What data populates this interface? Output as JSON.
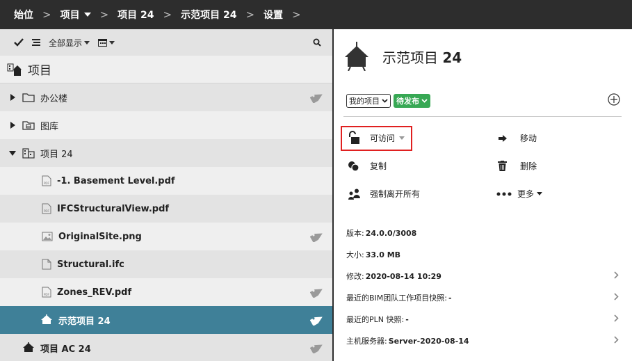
{
  "breadcrumb": {
    "items": [
      "始位",
      "项目",
      "项目 24",
      "示范项目 24",
      "设置"
    ],
    "separator": ">"
  },
  "toolbar": {
    "filter_label": "全部显示"
  },
  "tree": {
    "root_label": "项目",
    "rows": [
      {
        "label": "办公楼"
      },
      {
        "label": "图库"
      },
      {
        "label": "项目 24"
      },
      {
        "label": "-1. Basement Level.pdf"
      },
      {
        "label": "IFCStructuralView.pdf"
      },
      {
        "label": "OriginalSite.png"
      },
      {
        "label": "Structural.ifc"
      },
      {
        "label": "Zones_REV.pdf"
      },
      {
        "label": "示范项目 24"
      },
      {
        "label": "项目 AC 24"
      }
    ]
  },
  "detail": {
    "title_prefix": "示范项目",
    "title_number": "24",
    "project_select": "我的项目",
    "status_badge": "待发布",
    "actions": {
      "access": "可访问",
      "move": "移动",
      "copy": "复制",
      "delete": "删除",
      "force_leave": "强制离开所有",
      "more": "更多"
    },
    "info": [
      {
        "label": "版本:",
        "value": "24.0.0/3008"
      },
      {
        "label": "大小:",
        "value": "33.0 MB"
      },
      {
        "label": "修改:",
        "value": "2020-08-14 10:29"
      },
      {
        "label": "最近的BIM团队工作项目快照:",
        "value": "-"
      },
      {
        "label": "最近的PLN 快照:",
        "value": "-"
      },
      {
        "label": "主机服务器:",
        "value": "Server-2020-08-14"
      }
    ]
  },
  "colors": {
    "topbar": "#2d2d2d",
    "selected_row": "#3f8098",
    "status_badge": "#37a854",
    "highlight_box": "#e02020"
  }
}
